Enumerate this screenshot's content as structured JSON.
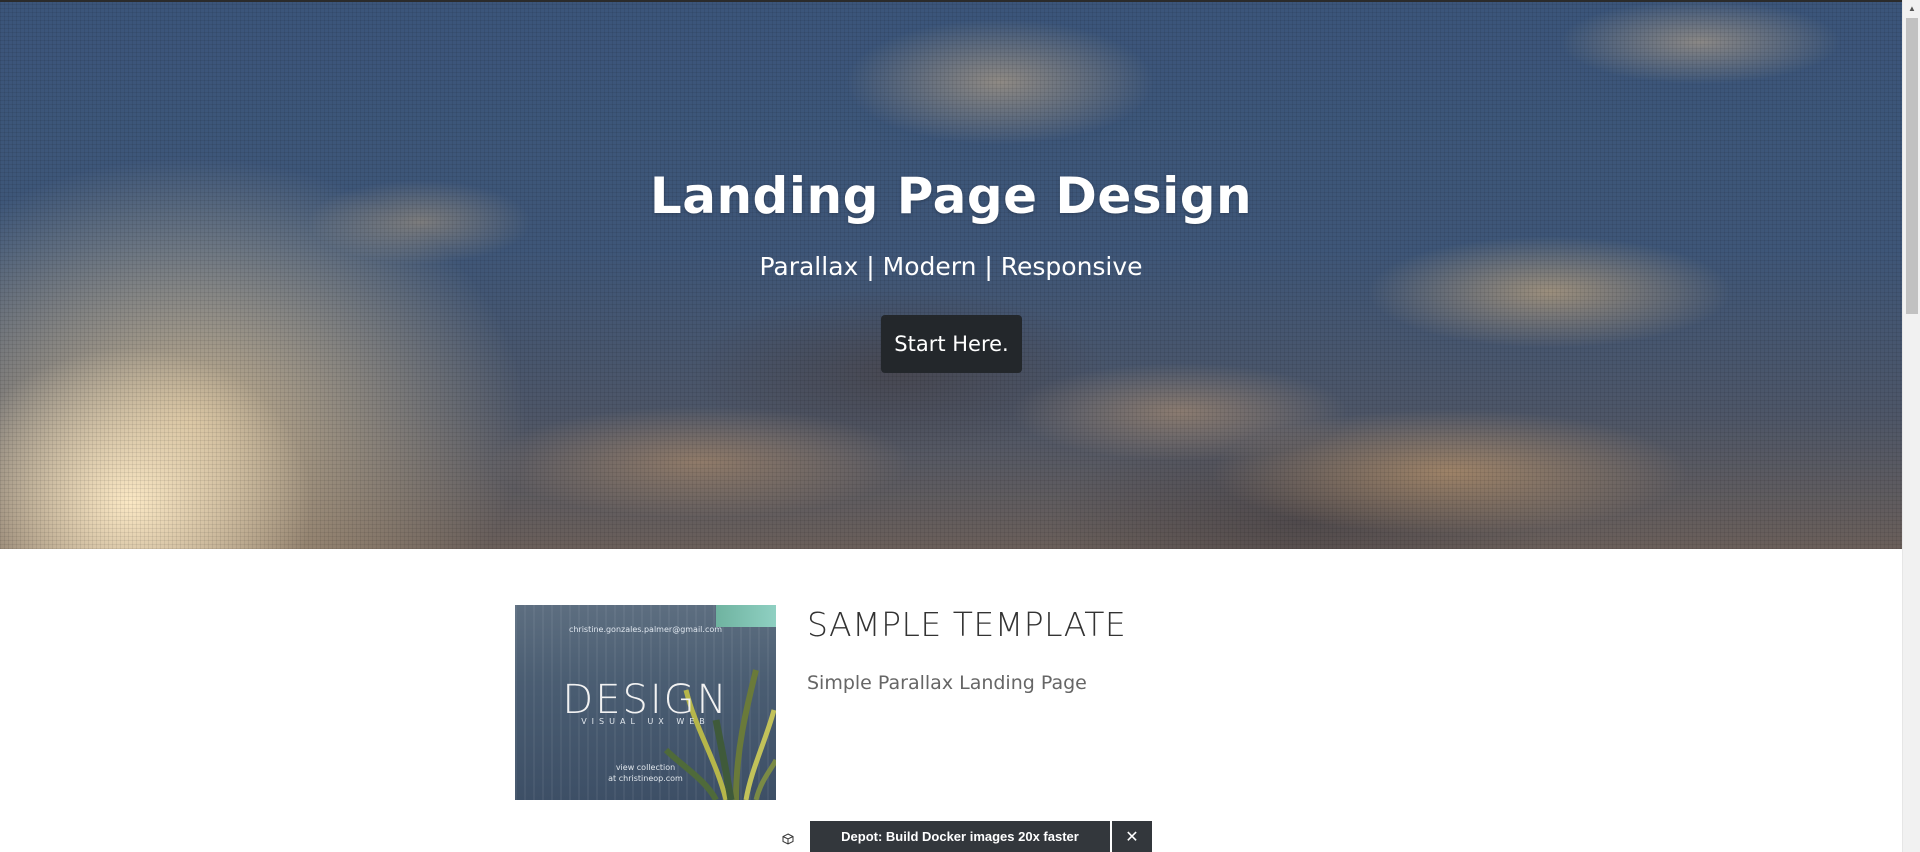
{
  "hero": {
    "title": "Landing Page Design",
    "subtitle": "Parallax | Modern | Responsive",
    "button_label": "Start Here."
  },
  "section": {
    "title": "SAMPLE TEMPLATE",
    "subtitle": "Simple Parallax Landing Page",
    "image": {
      "email": "christine.gonzales.palmer@gmail.com",
      "logo_text": "DESIGN",
      "tagline": "VISUAL UX WEB",
      "view_line1": "view collection",
      "view_line2": "at christineop.com"
    }
  },
  "ad": {
    "icon": "cube-icon",
    "text": "Depot: Build Docker images 20x faster",
    "close": "✕"
  },
  "colors": {
    "button_bg": "#23272b",
    "ad_bg": "#33373c"
  }
}
